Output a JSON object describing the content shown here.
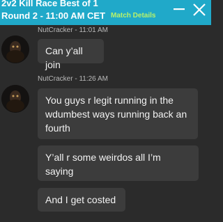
{
  "header": {
    "title": "2v2 Kill Race Best of 1",
    "round": "Round 2 - 11:00 AM CET",
    "match_details_label": "Match Details"
  },
  "icons": {
    "minimize": "minimize-icon",
    "close": "close-icon"
  },
  "colors": {
    "header_bg": "#20a9c9",
    "match_details": "#b8f26a",
    "chat_bg": "#2b2b2b",
    "bubble_bg": "#3c3c3c"
  },
  "messages": [
    {
      "author": "NutCracker",
      "time": "11:01 AM",
      "meta": "NutCracker - 11:01 AM",
      "texts": [
        "Can y’all join"
      ]
    },
    {
      "author": "NutCracker",
      "time": "11:26 AM",
      "meta": "NutCracker - 11:26 AM",
      "texts": [
        "You guys r legit running in the wdumbest ways running back an fourth",
        "Y’all r some weirdos all I’m saying",
        "And I get costed"
      ]
    }
  ]
}
